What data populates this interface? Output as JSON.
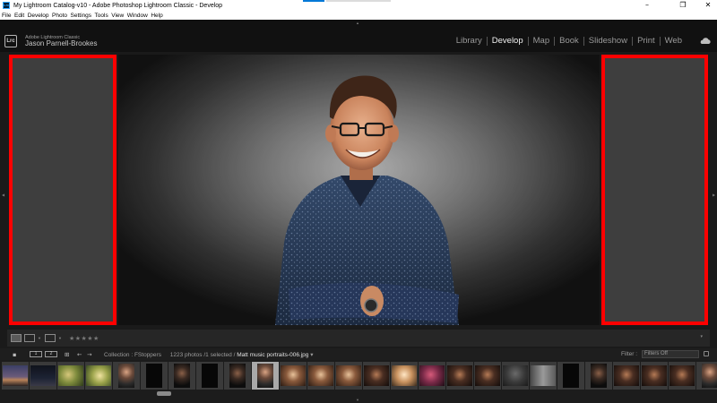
{
  "window": {
    "title": "My Lightroom Catalog-v10 - Adobe Photoshop Lightroom Classic - Develop",
    "app_icon_text": "Lrc",
    "minimize": "–",
    "maximize": "❐",
    "close": "✕"
  },
  "menu": [
    "File",
    "Edit",
    "Develop",
    "Photo",
    "Settings",
    "Tools",
    "View",
    "Window",
    "Help"
  ],
  "identity": {
    "logo": "Lrc",
    "product": "Adobe Lightroom Classic",
    "user": "Jason Parnell-Brookes"
  },
  "modules": [
    {
      "label": "Library",
      "active": false
    },
    {
      "label": "Develop",
      "active": true
    },
    {
      "label": "Map",
      "active": false
    },
    {
      "label": "Book",
      "active": false
    },
    {
      "label": "Slideshow",
      "active": false
    },
    {
      "label": "Print",
      "active": false
    },
    {
      "label": "Web",
      "active": false
    }
  ],
  "toolbar": {
    "rating": "★★★★★"
  },
  "filmstrip_header": {
    "monitor_1": "1",
    "monitor_2": "2",
    "collection": "Collection : FStoppers",
    "count": "1223 photos /1 selected /",
    "file": "Matt music portraits-006.jpg",
    "file_suffix": " ▾",
    "filter_label": "Filter :",
    "filter_value": "Filters Off"
  },
  "thumbnails": [
    {
      "tone": "dusk"
    },
    {
      "tone": "night"
    },
    {
      "tone": "leaf"
    },
    {
      "tone": "leaf2"
    },
    {
      "tone": "portrait",
      "portrait": true
    },
    {
      "tone": "black",
      "portrait": true
    },
    {
      "tone": "portrait-dark",
      "portrait": true
    },
    {
      "tone": "black",
      "portrait": true
    },
    {
      "tone": "portrait-dark",
      "portrait": true
    },
    {
      "tone": "portrait",
      "portrait": true,
      "selected": true
    },
    {
      "tone": "warm"
    },
    {
      "tone": "warm"
    },
    {
      "tone": "warm"
    },
    {
      "tone": "dark-warm"
    },
    {
      "tone": "bright"
    },
    {
      "tone": "magenta"
    },
    {
      "tone": "dark-warm"
    },
    {
      "tone": "dark-warm"
    },
    {
      "tone": "gray"
    },
    {
      "tone": "gray-light"
    },
    {
      "tone": "black",
      "portrait": true
    },
    {
      "tone": "portrait-dark",
      "portrait": true
    },
    {
      "tone": "dark-warm"
    },
    {
      "tone": "dark-warm"
    },
    {
      "tone": "dark-warm"
    },
    {
      "tone": "portrait",
      "portrait": true
    },
    {
      "tone": "dark-warm"
    }
  ]
}
